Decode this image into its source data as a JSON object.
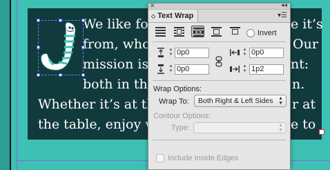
{
  "document": {
    "text_lines": [
      "We like foo",
      "from, who o",
      "mission is t",
      "both in the",
      "Whether it’s at the",
      "the table, enjoy wh"
    ],
    "right_fragments": [
      "e it’s",
      "Our",
      "nt:",
      "n.",
      "r at",
      "e to"
    ],
    "colors": {
      "background": "#3ec1b4",
      "text_frame": "#113a3d",
      "text": "#ffffff",
      "hidden_char_dot": "#e58a2e",
      "selection": "#3d56d8"
    }
  },
  "panel": {
    "title": "Text Wrap",
    "close_icon": "close-x-icon",
    "collapse_icon": "double-chevron-icon",
    "menu_icon": "panel-menu-icon",
    "wrap_buttons": [
      {
        "icon": "no-text-wrap-icon",
        "active": false
      },
      {
        "icon": "wrap-around-bounding-box-icon",
        "active": false
      },
      {
        "icon": "wrap-around-object-shape-icon",
        "active": true
      },
      {
        "icon": "jump-object-icon",
        "active": false
      },
      {
        "icon": "jump-to-next-column-icon",
        "active": false
      }
    ],
    "invert_label": "Invert",
    "offsets": {
      "top": "0p0",
      "bottom": "0p0",
      "left": "0p0",
      "right": "1p2"
    },
    "wrap_options_label": "Wrap Options:",
    "wrap_to_label": "Wrap To:",
    "wrap_to_value": "Both Right & Left Sides",
    "contour_options_label": "Contour Options:",
    "type_label": "Type:",
    "type_value": "",
    "include_inside_edges_label": "Include Inside Edges"
  }
}
